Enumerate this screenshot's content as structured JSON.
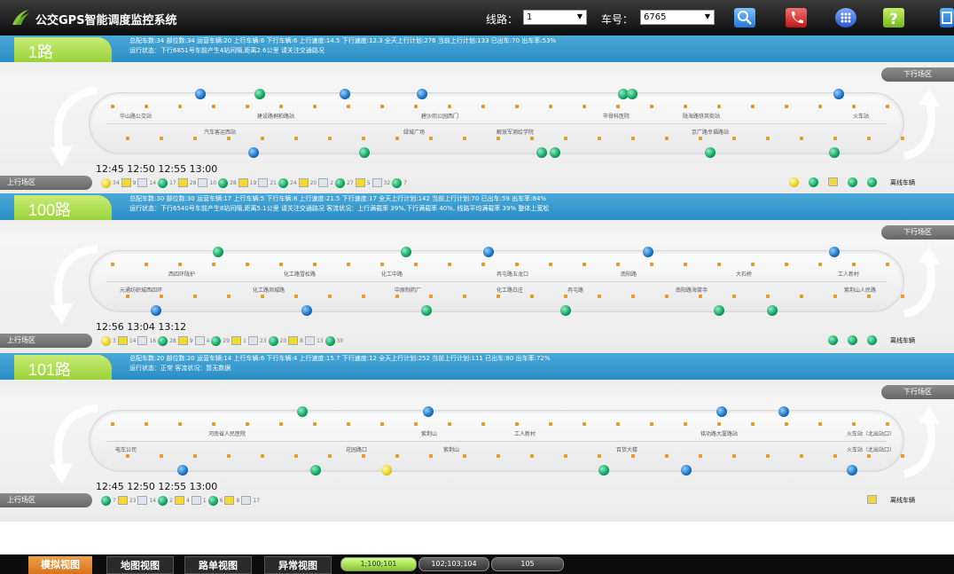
{
  "app": {
    "title": "公交GPS智能调度监控系统"
  },
  "toolbar": {
    "line_label": "线路：",
    "line_value": "1",
    "vehicle_label": "车号：",
    "vehicle_value": "6765",
    "icons": [
      "search-icon",
      "phone-icon",
      "grid-icon",
      "help-icon",
      "login-icon"
    ]
  },
  "routes": [
    {
      "name": "1路",
      "stats_line1": "总配车数:34  部位数:34  运营车辆:20  上行车辆:6  下行车辆:6  上行速度:14.5  下行速度:12.3  全天上行计划:276  当前上行计划:133  已出车:70  出车率:53%",
      "stats_line2": "运行状态：下行6851号车前产生4站间隔,距离2.6公里 请关注交通路况",
      "down_label": "下行场区",
      "up_label": "上行场区",
      "upper_stops": [
        "华山路公交站",
        "建设路桐柏路站",
        "碧沙岗公园西门",
        "市骨科医院",
        "陇海路铁英街站",
        "火车站"
      ],
      "lower_stops": [
        "汽车客运西站",
        "绿城广场",
        "解放军测绘学院",
        "京广路幸福路站"
      ],
      "times": "12:45 12:50 12:55 13:00",
      "legend_counts": [
        "34",
        "9",
        "14",
        "17",
        "28",
        "10",
        "28",
        "19",
        "21",
        "24",
        "20",
        "2",
        "27",
        "5",
        "32",
        "7"
      ],
      "offline_label": "离线车辆"
    },
    {
      "name": "100路",
      "stats_line1": "总配车数:30  部位数:30  运营车辆:17  上行车辆:5  下行车辆:8  上行速度:21.5  下行速度:17  全天上行计划:142  当前上行计划:70  已出车:59  出车率:84%",
      "stats_line2": "运行状态：下行6540号车前产生8站间隔,距离5.1公里 请关注交通路况  客流状况：上行满载率 39%,下行满载率 40%, 线路平均满载率 39%  整体上宽松",
      "down_label": "下行场区",
      "up_label": "上行场区",
      "upper_stops": [
        "西四环陇护",
        "化工路雪松路",
        "化工中路",
        "冉屯路五龙口",
        "南阳路",
        "大石桥",
        "工人新村"
      ],
      "lower_stops": [
        "元通纺织城西四环",
        "化工路须城路",
        "中原制药厂",
        "化工路白庄",
        "冉屯路",
        "南阳路海棠寺",
        "紫荆山人民路"
      ],
      "times": "12:56 13:04 13:12",
      "legend_counts": [
        "3",
        "14",
        "16",
        "28",
        "9",
        "4",
        "29",
        "1",
        "23",
        "20",
        "8",
        "13",
        "30"
      ],
      "offline_label": "离线车辆"
    },
    {
      "name": "101路",
      "stats_line1": "总配车数:20  部位数:20  运营车辆:14  上行车辆:6  下行车辆:4  上行速度:15.7  下行速度:12  全天上行计划:252  当前上行计划:111  已出车:80  出车率:72%",
      "stats_line2": "运行状态：正常  客流状况：暂无数据",
      "down_label": "下行场区",
      "up_label": "上行场区",
      "upper_stops": [
        "河南省人民医院",
        "紫荆山",
        "工人新村",
        "铭功路大厦路站",
        "火车站（北出站口）"
      ],
      "lower_stops": [
        "电车公司",
        "花园路口",
        "紫荆山",
        "百货大楼",
        "火车站（北出站口）"
      ],
      "times": "12:45 12:50 12:55 13:00",
      "legend_counts": [
        "7",
        "23",
        "14",
        "2",
        "4",
        "1",
        "6",
        "8",
        "17"
      ],
      "offline_label": "离线车辆"
    }
  ],
  "footer": {
    "tabs": [
      "模拟视图",
      "地图视图",
      "路单视图",
      "异常视图"
    ],
    "pills": [
      "1;100;101",
      "102;103;104",
      "105"
    ]
  }
}
